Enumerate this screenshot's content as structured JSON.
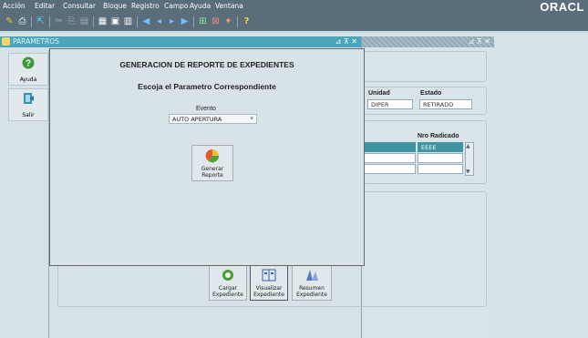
{
  "menu": [
    "Acción",
    "Editar",
    "Consultar",
    "Bloque",
    "Registro",
    "Campo",
    "Ayuda",
    "Ventana"
  ],
  "brand": "ORACL",
  "main_window": {
    "title": "PARAMETROS",
    "controls": "⊿ ⊼ ✕"
  },
  "second_window": {
    "controls": "⊿ ⊼ ✕"
  },
  "sidebar": {
    "help_label": "Ayuda",
    "exit_label": "Salir"
  },
  "dialog": {
    "title": "GENERACION DE REPORTE  DE  EXPEDIENTES",
    "subtitle": "Escoja el  Parametro Correspondiente",
    "event_label": "Evento",
    "event_value": "AUTO APERTURA",
    "generate_label": "Generar Reporte"
  },
  "background_form": {
    "unit_header": "Unidad",
    "state_header": "Estado",
    "unit_value": "DIPER",
    "state_value": "RETIRADO",
    "radicado_header": "Nro Radicado",
    "radicado_values": [
      "EEEE",
      "",
      ""
    ]
  },
  "bottom_buttons": {
    "load_label": "Cargar Expediente",
    "view_label": "Visualizar Expediente",
    "summary_label": "Resumen Expediente"
  }
}
